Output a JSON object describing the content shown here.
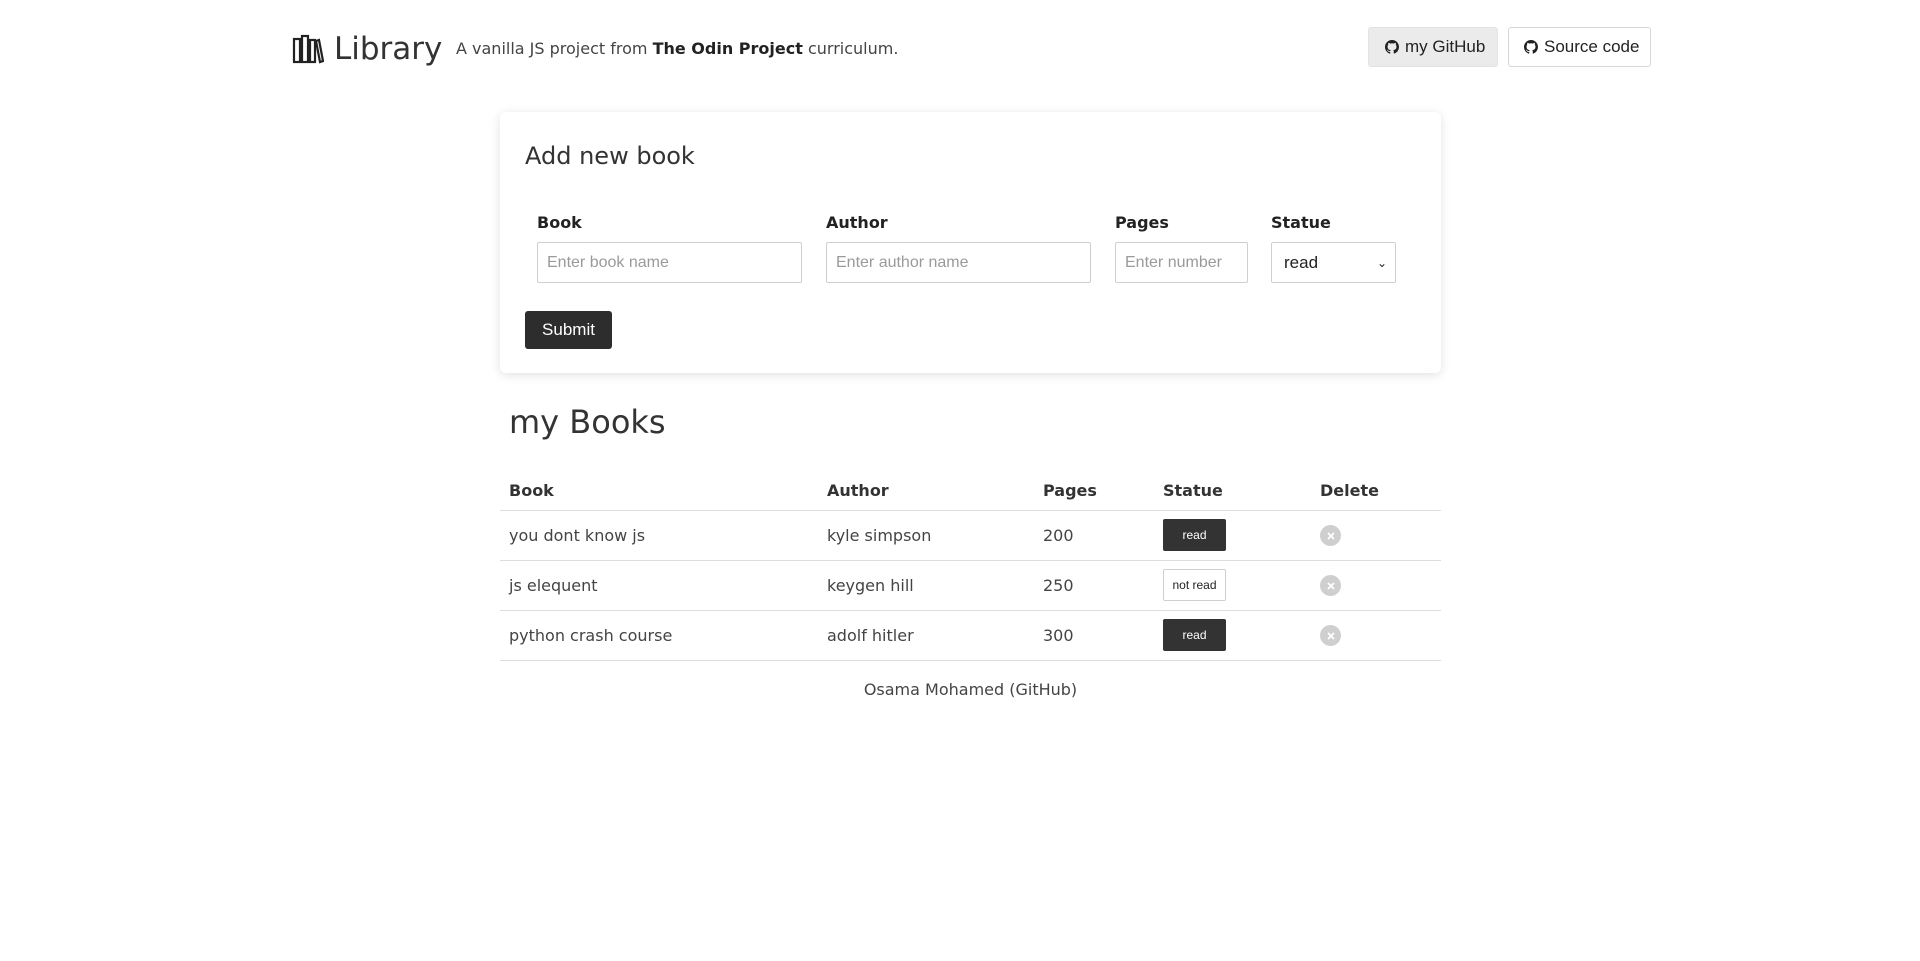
{
  "header": {
    "title": "Library",
    "tagline_prefix": "A vanilla JS project from ",
    "tagline_bold": "The Odin Project",
    "tagline_suffix": " curriculum.",
    "github_label": "my GitHub",
    "source_label": "Source code"
  },
  "form": {
    "title": "Add new book",
    "book_label": "Book",
    "book_placeholder": "Enter book name",
    "author_label": "Author",
    "author_placeholder": "Enter author name",
    "pages_label": "Pages",
    "pages_placeholder": "Enter number",
    "status_label": "Statue",
    "status_value": "read",
    "submit_label": "Submit"
  },
  "books": {
    "title": "my Books",
    "columns": [
      "Book",
      "Author",
      "Pages",
      "Statue",
      "Delete"
    ],
    "rows": [
      {
        "book": "you dont know js",
        "author": "kyle simpson",
        "pages": "200",
        "status": "read"
      },
      {
        "book": "js elequent",
        "author": "keygen hill",
        "pages": "250",
        "status": "not read"
      },
      {
        "book": "python crash course",
        "author": "adolf hitler",
        "pages": "300",
        "status": "read"
      }
    ]
  },
  "footer": {
    "text": "Osama Mohamed (GitHub)"
  },
  "colors": {
    "dark_button": "#2d2d2d",
    "border": "#dddddd",
    "delete_icon": "#cfcfcf"
  }
}
